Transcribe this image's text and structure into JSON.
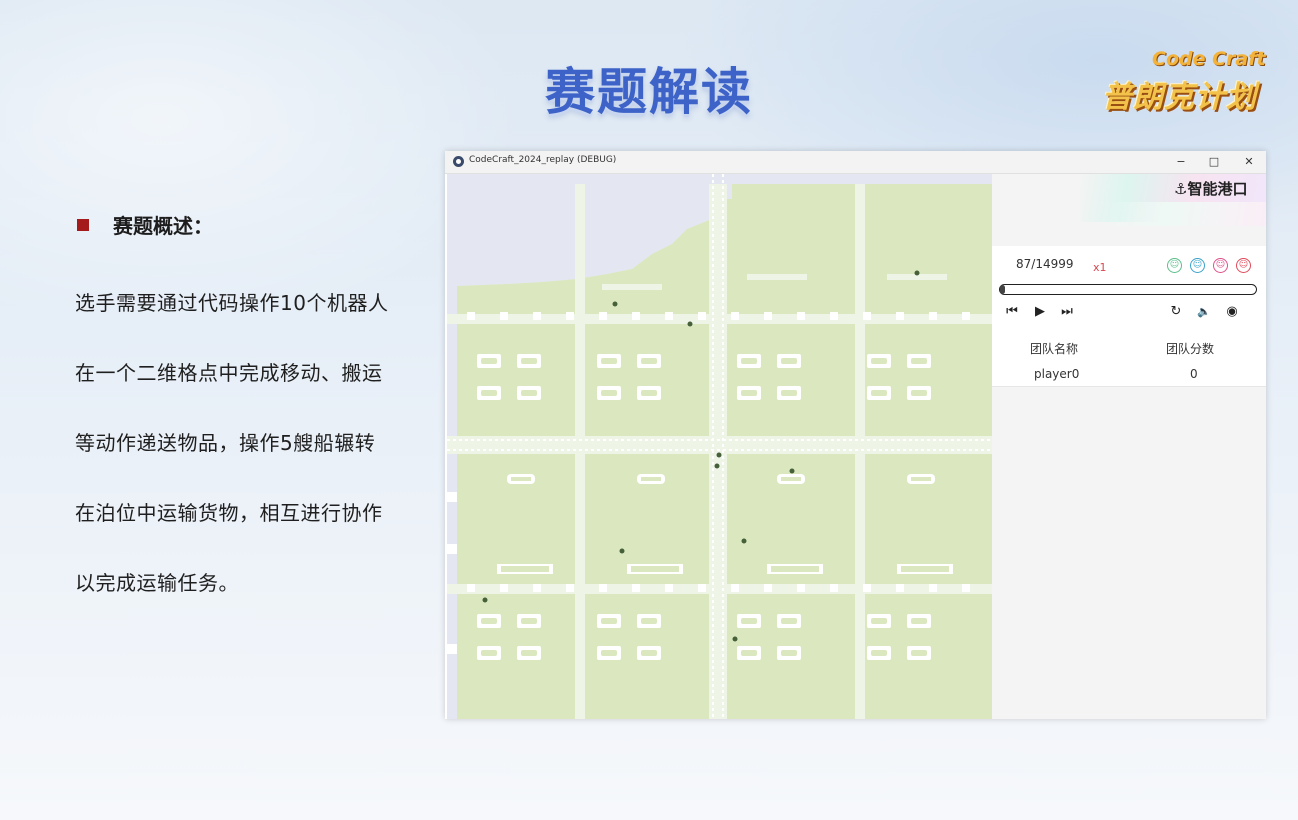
{
  "slide": {
    "title": "赛题解读",
    "logo_top": "Code Craft",
    "logo_main": "普朗克计划",
    "bullet_heading": "赛题概述：",
    "body_lines": [
      "选手需要通过代码操作10个机器人",
      "在一个二维格点中完成移动、搬运",
      "等动作递送物品，操作5艘船辗转",
      "在泊位中运输货物，相互进行协作",
      "以完成运输任务。"
    ]
  },
  "window": {
    "title": "CodeCraft_2024_replay (DEBUG)",
    "minimize": "−",
    "maximize": "□",
    "close": "✕"
  },
  "sidebar": {
    "brand": "⚓智能港口",
    "frame_counter": "87/14999",
    "speed": "x1",
    "progress": 0.0058,
    "team_icons": [
      {
        "name": "team-icon-green",
        "color": "#5bbf8a"
      },
      {
        "name": "team-icon-blue",
        "color": "#3aa3c9"
      },
      {
        "name": "team-icon-pink",
        "color": "#e0508a"
      },
      {
        "name": "team-icon-red",
        "color": "#e04a5a"
      }
    ],
    "controls": {
      "prev": "⏮",
      "play": "▶",
      "next": "⏭",
      "reset": "↻",
      "volume": "🔈",
      "view": "◉"
    },
    "table": {
      "headers": [
        "团队名称",
        "团队分数"
      ],
      "rows": [
        [
          "player0",
          "0"
        ]
      ]
    }
  },
  "colors": {
    "title": "#3d63c8",
    "bullet": "#a51b1b",
    "map_land": "#dbe8bf",
    "map_road": "#eef4e6",
    "map_bg": "#e4e7f2"
  }
}
